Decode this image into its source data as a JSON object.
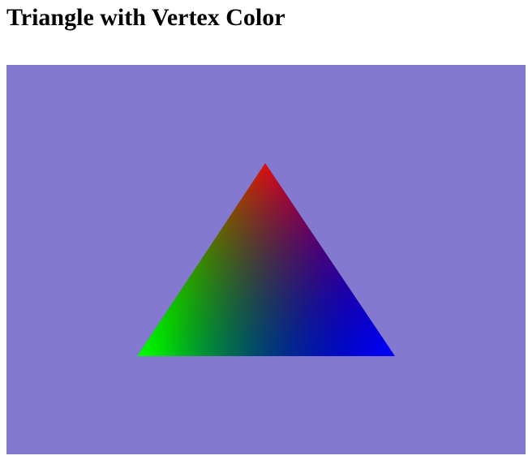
{
  "page": {
    "title": "Triangle with Vertex Color"
  },
  "canvas": {
    "clear_color": "#8479D0",
    "triangle": {
      "vertex_colors": {
        "top": "#FF0000",
        "bottom_left": "#00FF00",
        "bottom_right": "#0000FF"
      }
    }
  }
}
